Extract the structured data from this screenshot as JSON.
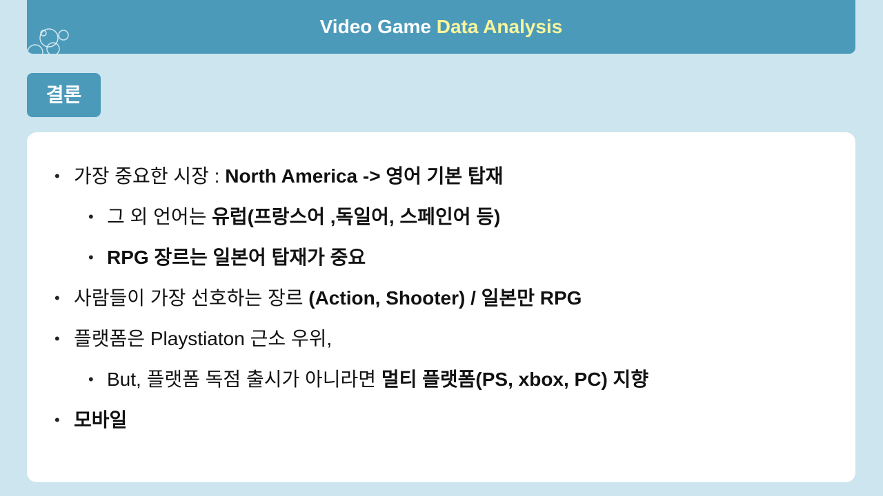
{
  "theme": {
    "primary": "#4b9aba",
    "highlight": "#f8f59c",
    "background": "#cce5ee",
    "card": "#ffffff"
  },
  "header": {
    "title_prefix": "Video Game",
    "title_highlight": "Data Analysis",
    "decoration_icon": "bubbles-icon"
  },
  "section": {
    "label": "결론"
  },
  "content": {
    "items": [
      {
        "level": 1,
        "text": "가장 중요한 시장 :",
        "bold_text": "North America -> 영어 기본 탑재"
      },
      {
        "level": 2,
        "text": "그 외 언어는",
        "bold_text": "유럽(프랑스어 ,독일어, 스페인어 등)"
      },
      {
        "level": 2,
        "bold_text": "RPG 장르는 일본어 탑재가 중요"
      },
      {
        "level": 1,
        "text": "사람들이 가장 선호하는 장르",
        "bold_text": "(Action, Shooter) / 일본만 RPG"
      },
      {
        "level": 1,
        "text": "플랫폼은 Playstiaton 근소 우위,"
      },
      {
        "level": 2,
        "text": "But, 플랫폼 독점 출시가 아니라면",
        "bold_text": "멀티 플랫폼(PS, xbox, PC) 지향"
      },
      {
        "level": 1,
        "bold_text": "모바일"
      }
    ]
  }
}
